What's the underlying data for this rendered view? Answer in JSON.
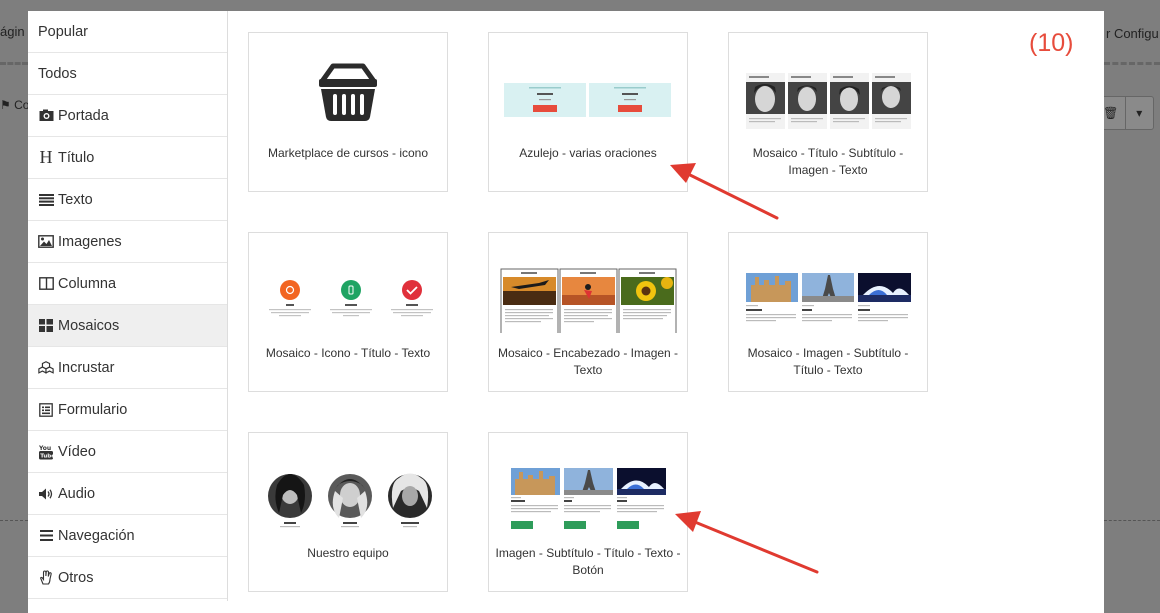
{
  "background": {
    "left_label": "ágin",
    "right_label": "r Configu",
    "left_button_label": "Co"
  },
  "counter": "(10)",
  "sidebar": {
    "items": [
      {
        "label": "Popular",
        "icon": ""
      },
      {
        "label": "Todos",
        "icon": ""
      },
      {
        "label": "Portada",
        "icon": "camera-icon"
      },
      {
        "label": "Título",
        "icon": "heading-icon"
      },
      {
        "label": "Texto",
        "icon": "text-lines-icon"
      },
      {
        "label": "Imagenes",
        "icon": "image-icon"
      },
      {
        "label": "Columna",
        "icon": "columns-icon"
      },
      {
        "label": "Mosaicos",
        "icon": "tiles-icon",
        "active": true
      },
      {
        "label": "Incrustar",
        "icon": "cubes-icon"
      },
      {
        "label": "Formulario",
        "icon": "form-icon"
      },
      {
        "label": "Vídeo",
        "icon": "youtube-icon"
      },
      {
        "label": "Audio",
        "icon": "volume-icon"
      },
      {
        "label": "Navegación",
        "icon": "bars-icon"
      },
      {
        "label": "Otros",
        "icon": "hand-icon"
      }
    ]
  },
  "blocks": [
    {
      "label": "Marketplace de cursos - icono",
      "preview": "basket-icon"
    },
    {
      "label": "Azulejo - varias oraciones",
      "preview": "tile-sentences"
    },
    {
      "label": "Mosaico - Título - Subtítulo - Imagen - Texto",
      "preview": "portrait-mosaic"
    },
    {
      "label": "Mosaico - Icono - Título - Texto",
      "preview": "icon-mosaic"
    },
    {
      "label": "Mosaico - Encabezado - Imagen - Texto",
      "preview": "header-image-mosaic"
    },
    {
      "label": "Mosaico - Imagen - Subtítulo - Título - Texto",
      "preview": "city-mosaic"
    },
    {
      "label": "Nuestro equipo",
      "preview": "team-circles"
    },
    {
      "label": "Imagen - Subtítulo - Título - Texto - Botón",
      "preview": "city-button-mosaic"
    }
  ],
  "colors": {
    "accent_red": "#e74c3c",
    "arrow_red": "#e03a30",
    "tile_teal": "#d9f1f2",
    "button_green": "#2e9c5a"
  }
}
